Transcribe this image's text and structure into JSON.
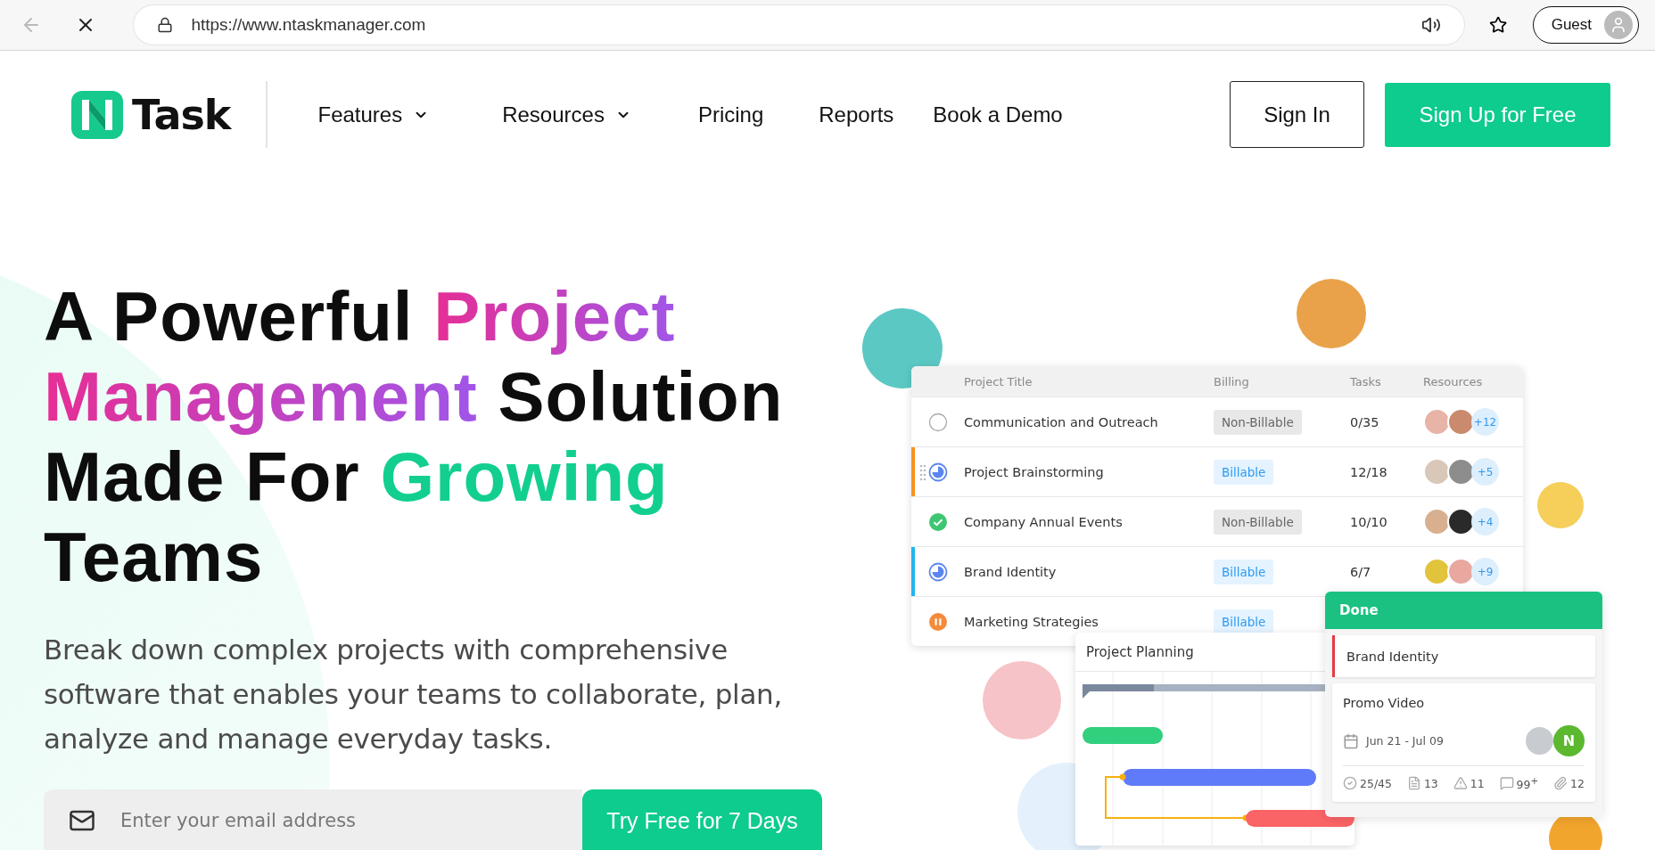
{
  "browser": {
    "url": "https://www.ntaskmanager.com",
    "profile": "Guest",
    "back_disabled": true
  },
  "nav": {
    "logo_text": "Task",
    "items": [
      {
        "label": "Features",
        "dropdown": true
      },
      {
        "label": "Resources",
        "dropdown": true
      },
      {
        "label": "Pricing",
        "dropdown": false
      },
      {
        "label": "Reports",
        "dropdown": false
      },
      {
        "label": "Book a Demo",
        "dropdown": false
      }
    ],
    "sign_in": "Sign In",
    "sign_up": "Sign Up for Free"
  },
  "hero": {
    "title_lines": [
      [
        {
          "text": "A Powerful ",
          "kind": "plain"
        },
        {
          "text": "Project",
          "kind": "gradient"
        }
      ],
      [
        {
          "text": "Management",
          "kind": "gradient"
        },
        {
          "text": " Solution",
          "kind": "plain"
        }
      ],
      [
        {
          "text": "Made For ",
          "kind": "plain"
        },
        {
          "text": "Growing",
          "kind": "green"
        }
      ],
      [
        {
          "text": "Teams",
          "kind": "plain"
        }
      ]
    ],
    "description": "Break down complex projects with comprehensive software that enables your teams to collaborate, plan, analyze and manage everyday tasks.",
    "email_placeholder": "Enter your email address",
    "cta": "Try Free for 7 Days"
  },
  "table": {
    "columns": [
      "Project Title",
      "Billing",
      "Tasks",
      "Resources"
    ],
    "rows": [
      {
        "kind": "todo",
        "title": "Communication and Outreach",
        "billing": "Non-Billable",
        "billable": false,
        "tasks": "0/35",
        "more": "+12",
        "hovered": false
      },
      {
        "kind": "in_progress",
        "title": "Project Brainstorming",
        "billing": "Billable",
        "billable": true,
        "tasks": "12/18",
        "more": "+5",
        "hovered": true,
        "color": "#f7931e"
      },
      {
        "kind": "done",
        "title": "Company Annual Events",
        "billing": "Non-Billable",
        "billable": false,
        "tasks": "10/10",
        "more": "+4",
        "hovered": false
      },
      {
        "kind": "in_progress",
        "title": "Brand Identity",
        "billing": "Billable",
        "billable": true,
        "tasks": "6/7",
        "more": "+9",
        "hovered": false,
        "color": "#1fb5f0"
      },
      {
        "kind": "paused",
        "title": "Marketing Strategies",
        "billing": "Billable",
        "billable": true,
        "hovered": false
      }
    ]
  },
  "gantt": {
    "title": "Project Planning"
  },
  "board": {
    "column": "Done",
    "cards": [
      {
        "kind": "simple",
        "title": "Brand Identity",
        "color": "#e53945"
      },
      {
        "kind": "detailed",
        "title": "Promo Video",
        "dates": "Jun 21 - Jul 09",
        "initial": "N",
        "stats": [
          {
            "kind": "checklist",
            "value": "25/45"
          },
          {
            "kind": "notes",
            "value": "13"
          },
          {
            "kind": "issues",
            "value": "11"
          },
          {
            "kind": "comments",
            "value": "99$^{+}$"
          },
          {
            "kind": "attachments",
            "value": "12"
          }
        ]
      }
    ]
  }
}
